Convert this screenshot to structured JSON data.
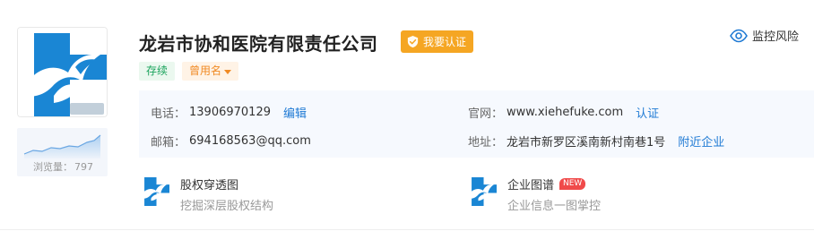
{
  "company": {
    "name": "龙岩市协和医院有限责任公司",
    "verify_label": "我要认证",
    "status_tag": "存续",
    "former_name_label": "曾用名",
    "monitor_label": "监控风险"
  },
  "stats": {
    "views_label": "浏览量：",
    "views_count": "797"
  },
  "contact": {
    "phone_label": "电话：",
    "phone_value": "13906970129",
    "phone_action": "编辑",
    "email_label": "邮箱：",
    "email_value": "694168563@qq.com",
    "website_label": "官网：",
    "website_value": "www.xiehefuke.com",
    "website_action": "认证",
    "address_label": "地址：",
    "address_value": "龙岩市新罗区溪南新村南巷1号",
    "address_action": "附近企业"
  },
  "tools": [
    {
      "title": "股权穿透图",
      "subtitle": "挖掘深层股权结构",
      "badge": ""
    },
    {
      "title": "企业图谱",
      "subtitle": "企业信息一图掌控",
      "badge": "NEW"
    }
  ],
  "colors": {
    "logo_blue": "#1a86d4",
    "verify_orange": "#f5a623",
    "link_blue": "#1f7ad4",
    "status_green": "#1ba35c",
    "former_orange": "#f08a24",
    "panel_bg": "#f6f9fe",
    "new_red": "#f04a4a"
  },
  "icons": {
    "logo": "hospital-cross-bird-logo",
    "verify": "shield-check-icon",
    "monitor": "eye-icon",
    "sparkline": "views-sparkline",
    "tool": "company-logo-thumbnail"
  }
}
